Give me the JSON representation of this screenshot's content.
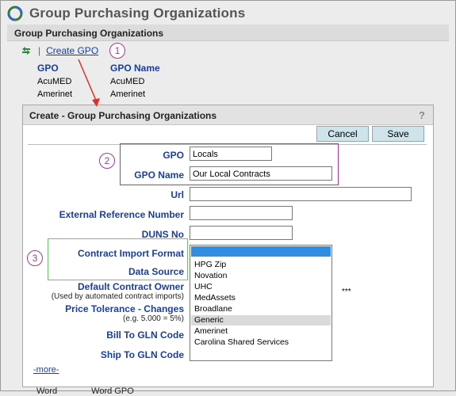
{
  "app": {
    "title": "Group Purchasing Organizations"
  },
  "section": {
    "title": "Group Purchasing Organizations"
  },
  "toolbar": {
    "create_label": "Create GPO"
  },
  "badges": {
    "one": "1",
    "two": "2",
    "three": "3"
  },
  "gpo_list": {
    "headers": {
      "gpo": "GPO",
      "name": "GPO Name"
    },
    "rows": [
      {
        "gpo": "AcuMED",
        "name": "AcuMED"
      },
      {
        "gpo": "Amerinet",
        "name": "Amerinet"
      }
    ]
  },
  "dialog": {
    "title": "Create - Group Purchasing Organizations",
    "help": "?",
    "cancel_label": "Cancel",
    "save_label": "Save",
    "fields": {
      "gpo_label": "GPO",
      "gpo_value": "Locals",
      "gpo_name_label": "GPO Name",
      "gpo_name_value": "Our Local Contracts",
      "url_label": "Url",
      "url_value": "",
      "extref_label": "External Reference Number",
      "extref_value": "",
      "duns_label": "DUNS No",
      "duns_value": "",
      "contract_import_label": "Contract Import Format",
      "data_source_label": "Data Source",
      "default_owner_label": "Default Contract Owner",
      "default_owner_sub": "(Used by automated contract imports)",
      "default_owner_value": "***",
      "price_tol_label": "Price Tolerance - Changes",
      "price_tol_sub": "(e.g. 5.000 = 5%)",
      "bill_to_label": "Bill To GLN Code",
      "ship_to_label": "Ship To GLN Code"
    },
    "more_link": "-more-",
    "dropdown_options": [
      "HPG Zip",
      "Novation",
      "UHC",
      "MedAssets",
      "Broadlane",
      "Generic",
      "Amerinet",
      "Carolina Shared Services"
    ],
    "dropdown_selected": "Generic"
  },
  "footer_partial": {
    "a": "Word",
    "b": "Word GPO"
  },
  "colors": {
    "label_blue": "#1b3e9c",
    "annotation_purple": "#a33a9b",
    "annotation_green": "#6cc36b",
    "annotation_red": "#d9322b",
    "button_bg": "#cfe3ea",
    "dropdown_highlight": "#2f8ee0"
  }
}
